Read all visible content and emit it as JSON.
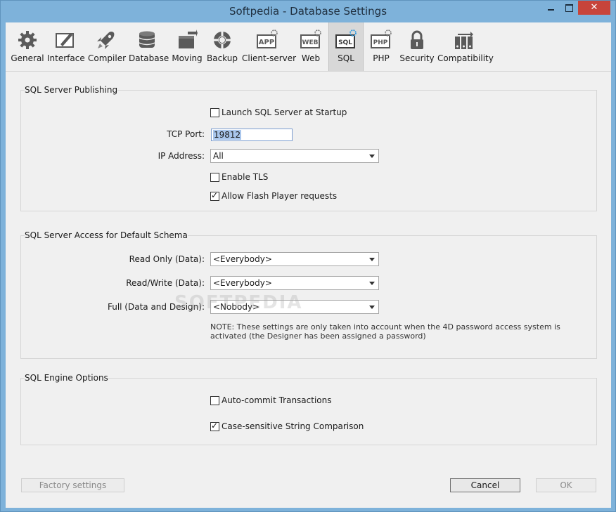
{
  "window": {
    "title": "Softpedia - Database Settings",
    "close_glyph": "✕"
  },
  "toolbar": {
    "items": [
      {
        "label": "General",
        "icon": "gear-icon"
      },
      {
        "label": "Interface",
        "icon": "interface-icon"
      },
      {
        "label": "Compiler",
        "icon": "rocket-icon"
      },
      {
        "label": "Database",
        "icon": "database-icon"
      },
      {
        "label": "Moving",
        "icon": "box-arrow-icon"
      },
      {
        "label": "Backup",
        "icon": "lifebuoy-icon"
      },
      {
        "label": "Client-server",
        "icon": "app-icon",
        "icon_text": "APP"
      },
      {
        "label": "Web",
        "icon": "web-icon",
        "icon_text": "WEB"
      },
      {
        "label": "SQL",
        "icon": "sql-icon",
        "icon_text": "SQL",
        "active": true
      },
      {
        "label": "PHP",
        "icon": "php-icon",
        "icon_text": "PHP"
      },
      {
        "label": "Security",
        "icon": "lock-icon"
      },
      {
        "label": "Compatibility",
        "icon": "compatibility-icon"
      }
    ]
  },
  "publishing": {
    "title": "SQL Server Publishing",
    "launch_label": "Launch SQL Server at Startup",
    "launch_checked": false,
    "tcp_port_label": "TCP Port:",
    "tcp_port_value": "19812",
    "ip_address_label": "IP Address:",
    "ip_address_value": "All",
    "tls_label": "Enable TLS",
    "tls_checked": false,
    "flash_label": "Allow Flash Player requests",
    "flash_checked": true
  },
  "access": {
    "title": "SQL Server Access for Default Schema",
    "read_only_label": "Read Only (Data):",
    "read_only_value": "<Everybody>",
    "read_write_label": "Read/Write (Data):",
    "read_write_value": "<Everybody>",
    "full_label": "Full (Data and Design):",
    "full_value": "<Nobody>",
    "note": "NOTE: These settings are only taken into account when the 4D password access system is activated (the Designer has been assigned a password)"
  },
  "engine": {
    "title": "SQL Engine Options",
    "autocommit_label": "Auto-commit Transactions",
    "autocommit_checked": false,
    "case_label": "Case-sensitive String Comparison",
    "case_checked": true
  },
  "footer": {
    "factory_label": "Factory settings",
    "cancel_label": "Cancel",
    "ok_label": "OK"
  },
  "watermark": "SOFTPEDIA"
}
